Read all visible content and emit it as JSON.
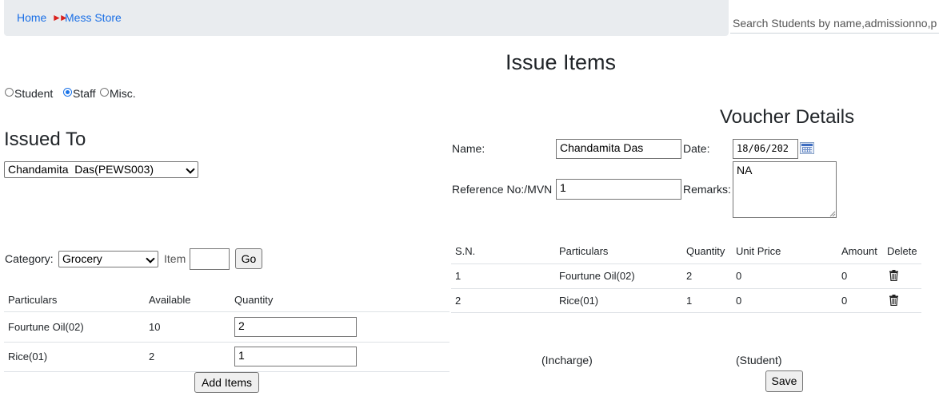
{
  "breadcrumb": {
    "home": "Home",
    "separator": "»",
    "current": "Mess Store"
  },
  "search": {
    "placeholder": "Search Students by name,admissionno,p"
  },
  "page_title": "Issue Items",
  "issue_type": {
    "options": [
      "Student",
      "Staff",
      "Misc."
    ],
    "selected": "Staff"
  },
  "issued_to": {
    "heading": "Issued To",
    "selected": "Chandamita  Das(PEWS003)"
  },
  "filter": {
    "category_label": "Category:",
    "category_value": "Grocery",
    "item_label": "Item",
    "item_value": "",
    "go_label": "Go"
  },
  "items_table": {
    "headers": [
      "Particulars",
      "Available",
      "Quantity"
    ],
    "rows": [
      {
        "particulars": "Fourtune Oil(02)",
        "available": "10",
        "quantity": "2"
      },
      {
        "particulars": "Rice(01)",
        "available": "2",
        "quantity": "1"
      }
    ],
    "add_label": "Add Items"
  },
  "voucher": {
    "heading": "Voucher Details",
    "name_label": "Name:",
    "name_value": "Chandamita  Das",
    "date_label": "Date:",
    "date_value": "18/06/202",
    "ref_label": "Reference No:/MVN",
    "ref_value": "1",
    "remarks_label": "Remarks:",
    "remarks_value": "NA"
  },
  "voucher_table": {
    "headers": [
      "S.N.",
      "Particulars",
      "Quantity",
      "Unit Price",
      "Amount",
      "Delete"
    ],
    "rows": [
      {
        "sn": "1",
        "particulars": "Fourtune Oil(02)",
        "quantity": "2",
        "unit_price": "0",
        "amount": "0",
        "delete_icon": "trash-icon"
      },
      {
        "sn": "2",
        "particulars": "Rice(01)",
        "quantity": "1",
        "unit_price": "0",
        "amount": "0",
        "delete_icon": "trash-icon"
      }
    ]
  },
  "signatures": {
    "incharge": "(Incharge)",
    "student": "(Student)"
  },
  "save_label": "Save",
  "colors": {
    "link": "#1a6fe6",
    "breadcrumb_bg": "#e9ecef",
    "separator": "#d9211d",
    "radio_selected": "#1a73e8"
  }
}
